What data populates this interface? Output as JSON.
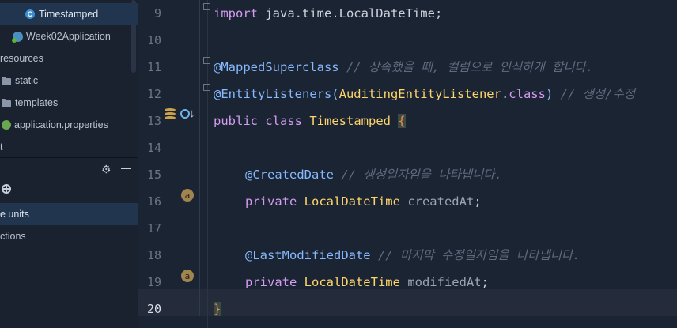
{
  "project_tree": {
    "items": [
      {
        "label": "Timestamped",
        "icon": "class-icon",
        "selected": true
      },
      {
        "label": "Week02Application",
        "icon": "spring-app-icon"
      },
      {
        "label": "resources",
        "icon": "none"
      },
      {
        "label": "static",
        "icon": "folder-icon"
      },
      {
        "label": "templates",
        "icon": "folder-icon"
      },
      {
        "label": "application.properties",
        "icon": "spring-properties-icon"
      },
      {
        "label": "t",
        "icon": "none"
      }
    ]
  },
  "lower_panel": {
    "items": [
      {
        "label": "e units",
        "selected": true
      },
      {
        "label": "ctions"
      }
    ]
  },
  "editor": {
    "line_numbers": [
      "9",
      "10",
      "11",
      "12",
      "13",
      "14",
      "15",
      "16",
      "17",
      "18",
      "19",
      "20"
    ],
    "current_line": "20",
    "lines": {
      "l9_kw": "import ",
      "l9_rest": "java.time.LocalDateTime;",
      "l11_ann": "@MappedSuperclass",
      "l11_cmt": " // 상속했을 때, 컬럼으로 인식하게 합니다.",
      "l12_ann": "@EntityListeners(",
      "l12_cls": "AuditingEntityListener",
      "l12_dot": ".",
      "l12_kw": "class",
      "l12_close": ")",
      "l12_cmt": " // 생성/수정",
      "l13_kw": "public class ",
      "l13_cls": "Timestamped",
      "l13_brace": "{",
      "l15_ann": "@CreatedDate",
      "l15_cmt": " // 생성일자임을 나타냅니다.",
      "l16_kw": "private ",
      "l16_cls": "LocalDateTime ",
      "l16_var": "createdAt",
      "l16_semi": ";",
      "l18_ann": "@LastModifiedDate",
      "l18_cmt": " // 마지막 수정일자임을 나타냅니다.",
      "l19_kw": "private ",
      "l19_cls": "LocalDateTime ",
      "l19_var": "modifiedAt",
      "l19_semi": ";",
      "l20_brace": "}"
    },
    "badge_letter": "a"
  },
  "colors": {
    "keyword": "#d49cf0",
    "class_name": "#ffd56b",
    "annotation": "#87b9ff",
    "comment": "#5f6b7e",
    "field": "#9aa4b4"
  }
}
